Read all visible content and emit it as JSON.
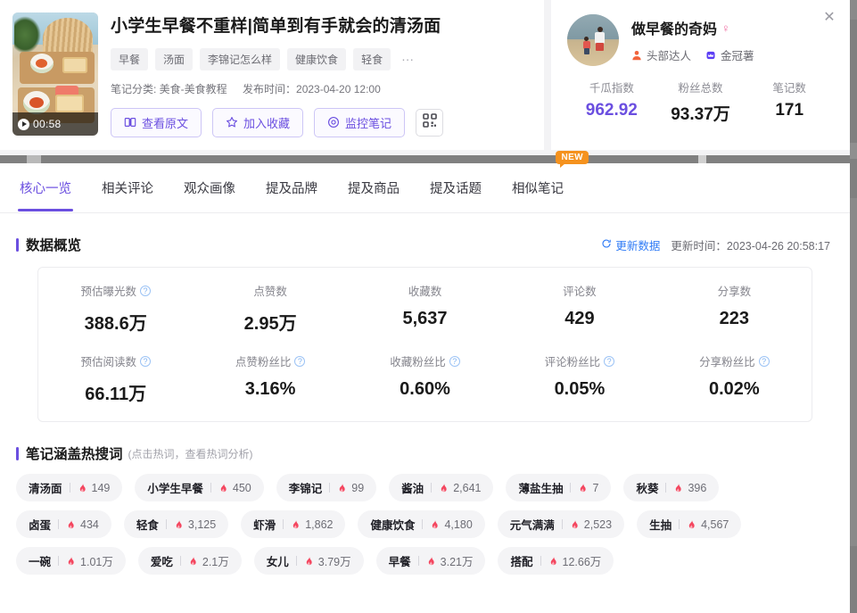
{
  "note": {
    "title": "小学生早餐不重样|简单到有手就会的清汤面",
    "duration": "00:58",
    "tags": [
      "早餐",
      "汤面",
      "李锦记怎么样",
      "健康饮食",
      "轻食"
    ],
    "tags_more": "···",
    "category_line": "笔记分类: 美食-美食教程",
    "publish_line": "发布时间：2023-04-20 12:00",
    "buttons": {
      "view_source": "查看原文",
      "add_favorite": "加入收藏",
      "monitor_note": "监控笔记"
    }
  },
  "author": {
    "name": "做早餐的奇妈",
    "gender_icon": "female-icon",
    "badges": [
      {
        "icon": "person-icon",
        "label": "头部达人"
      },
      {
        "icon": "crown-icon",
        "label": "金冠薯"
      }
    ],
    "stats": [
      {
        "label": "千瓜指数",
        "value": "962.92",
        "accent": true
      },
      {
        "label": "粉丝总数",
        "value": "93.37万",
        "accent": false
      },
      {
        "label": "笔记数",
        "value": "171",
        "accent": false
      }
    ],
    "close_icon": "close-icon"
  },
  "tabs": [
    {
      "label": "核心一览",
      "active": true,
      "badge": ""
    },
    {
      "label": "相关评论",
      "active": false,
      "badge": ""
    },
    {
      "label": "观众画像",
      "active": false,
      "badge": ""
    },
    {
      "label": "提及品牌",
      "active": false,
      "badge": ""
    },
    {
      "label": "提及商品",
      "active": false,
      "badge": ""
    },
    {
      "label": "提及话题",
      "active": false,
      "badge": ""
    },
    {
      "label": "相似笔记",
      "active": false,
      "badge": "NEW"
    }
  ],
  "overview": {
    "title": "数据概览",
    "refresh_label": "更新数据",
    "update_time": "更新时间：2023-04-26 20:58:17",
    "rows": [
      [
        {
          "label": "预估曝光数",
          "help": true,
          "value": "388.6万"
        },
        {
          "label": "点赞数",
          "help": false,
          "value": "2.95万"
        },
        {
          "label": "收藏数",
          "help": false,
          "value": "5,637"
        },
        {
          "label": "评论数",
          "help": false,
          "value": "429"
        },
        {
          "label": "分享数",
          "help": false,
          "value": "223"
        }
      ],
      [
        {
          "label": "预估阅读数",
          "help": true,
          "value": "66.11万"
        },
        {
          "label": "点赞粉丝比",
          "help": true,
          "value": "3.16%"
        },
        {
          "label": "收藏粉丝比",
          "help": true,
          "value": "0.60%"
        },
        {
          "label": "评论粉丝比",
          "help": true,
          "value": "0.05%"
        },
        {
          "label": "分享粉丝比",
          "help": true,
          "value": "0.02%"
        }
      ]
    ]
  },
  "hotwords": {
    "title": "笔记涵盖热搜词",
    "subtitle": "(点击热词，查看热词分析)",
    "items": [
      {
        "word": "清汤面",
        "count": "149"
      },
      {
        "word": "小学生早餐",
        "count": "450"
      },
      {
        "word": "李锦记",
        "count": "99"
      },
      {
        "word": "酱油",
        "count": "2,641"
      },
      {
        "word": "薄盐生抽",
        "count": "7"
      },
      {
        "word": "秋葵",
        "count": "396"
      },
      {
        "word": "卤蛋",
        "count": "434"
      },
      {
        "word": "轻食",
        "count": "3,125"
      },
      {
        "word": "虾滑",
        "count": "1,862"
      },
      {
        "word": "健康饮食",
        "count": "4,180"
      },
      {
        "word": "元气满满",
        "count": "2,523"
      },
      {
        "word": "生抽",
        "count": "4,567"
      },
      {
        "word": "一碗",
        "count": "1.01万"
      },
      {
        "word": "爱吃",
        "count": "2.1万"
      },
      {
        "word": "女儿",
        "count": "3.79万"
      },
      {
        "word": "早餐",
        "count": "3.21万"
      },
      {
        "word": "搭配",
        "count": "12.66万"
      }
    ]
  },
  "colors": {
    "accent_purple": "#6b4fe0",
    "link_blue": "#2f7bf6",
    "fire_red": "#f4465f",
    "badge_orange": "#f5921e",
    "female_pink": "#f06aa0"
  }
}
